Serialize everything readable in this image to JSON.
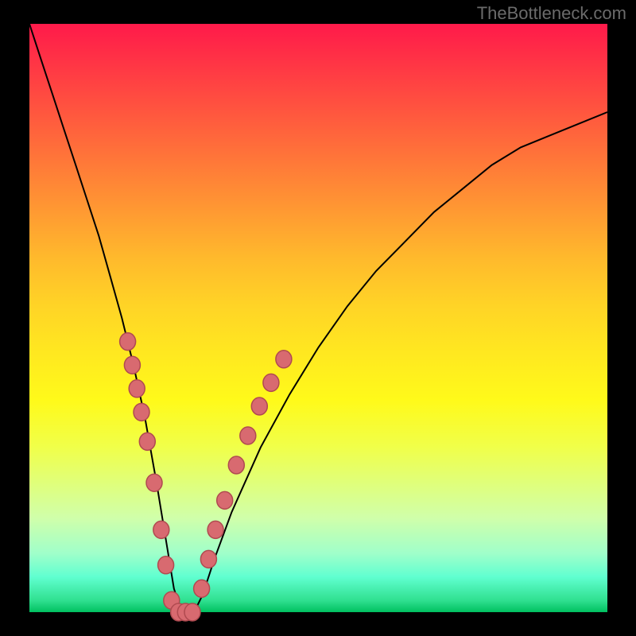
{
  "watermark": "TheBottleneck.com",
  "colors": {
    "gradient_top": "#ff1a4a",
    "gradient_mid": "#ffd426",
    "gradient_bottom": "#00c060",
    "curve": "#000000",
    "bead_fill": "#d86a70",
    "bead_stroke": "#b04a50",
    "background": "#000000"
  },
  "chart_data": {
    "type": "line",
    "title": "",
    "xlabel": "",
    "ylabel": "",
    "xlim": [
      0,
      100
    ],
    "ylim": [
      0,
      100
    ],
    "series": [
      {
        "name": "curve",
        "x": [
          0,
          2,
          4,
          6,
          8,
          10,
          12,
          14,
          16,
          18,
          20,
          22,
          24,
          25,
          26,
          27,
          28,
          29,
          30,
          32,
          35,
          40,
          45,
          50,
          55,
          60,
          65,
          70,
          75,
          80,
          85,
          90,
          95,
          100
        ],
        "y": [
          100,
          94,
          88,
          82,
          76,
          70,
          64,
          57,
          50,
          42,
          33,
          22,
          10,
          4,
          1,
          0,
          0,
          1,
          3,
          9,
          17,
          28,
          37,
          45,
          52,
          58,
          63,
          68,
          72,
          76,
          79,
          81,
          83,
          85
        ]
      }
    ],
    "beads_left": [
      {
        "x": 17.0,
        "y": 46
      },
      {
        "x": 17.8,
        "y": 42
      },
      {
        "x": 18.6,
        "y": 38
      },
      {
        "x": 19.4,
        "y": 34
      },
      {
        "x": 20.4,
        "y": 29
      },
      {
        "x": 21.6,
        "y": 22
      },
      {
        "x": 22.8,
        "y": 14
      },
      {
        "x": 23.6,
        "y": 8
      },
      {
        "x": 24.6,
        "y": 2
      }
    ],
    "beads_bottom": [
      {
        "x": 25.8,
        "y": 0
      },
      {
        "x": 27.0,
        "y": 0
      },
      {
        "x": 28.2,
        "y": 0
      }
    ],
    "beads_right": [
      {
        "x": 29.8,
        "y": 4
      },
      {
        "x": 31.0,
        "y": 9
      },
      {
        "x": 32.2,
        "y": 14
      },
      {
        "x": 33.8,
        "y": 19
      },
      {
        "x": 35.8,
        "y": 25
      },
      {
        "x": 37.8,
        "y": 30
      },
      {
        "x": 39.8,
        "y": 35
      },
      {
        "x": 41.8,
        "y": 39
      },
      {
        "x": 44.0,
        "y": 43
      }
    ]
  }
}
